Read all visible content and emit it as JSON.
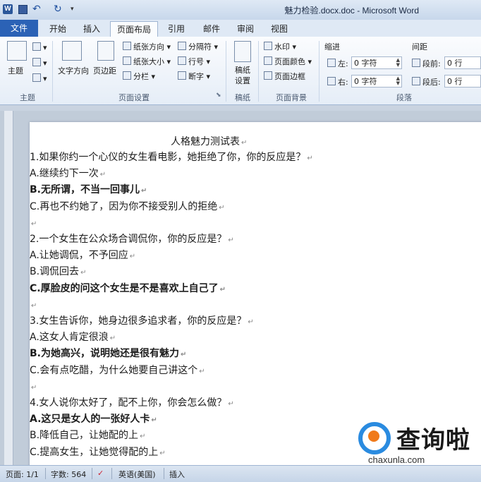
{
  "window": {
    "title": "魅力检验.docx.doc - Microsoft Word",
    "app_logo": "W"
  },
  "tabs": [
    {
      "label": "文件"
    },
    {
      "label": "开始"
    },
    {
      "label": "插入"
    },
    {
      "label": "页面布局"
    },
    {
      "label": "引用"
    },
    {
      "label": "邮件"
    },
    {
      "label": "审阅"
    },
    {
      "label": "视图"
    }
  ],
  "ribbon": {
    "theme": {
      "main": "主题",
      "group": "主题"
    },
    "page_setup": {
      "text_direction": "文字方向",
      "margins": "页边距",
      "orientation": "纸张方向",
      "size": "纸张大小",
      "columns": "分栏",
      "breaks": "分隔符",
      "line_numbers": "行号",
      "hyphenation": "断字",
      "group": "页面设置"
    },
    "paper": {
      "label": "稿纸设置",
      "group": "稿纸"
    },
    "page_background": {
      "watermark": "水印",
      "page_color": "页面颜色",
      "page_border": "页面边框",
      "group": "页面背景"
    },
    "paragraph": {
      "indent": "缩进",
      "left": "左:",
      "left_value": "0 字符",
      "right": "右:",
      "right_value": "0 字符",
      "spacing": "间距",
      "before": "段前:",
      "before_value": "0 行",
      "after": "段后:",
      "after_value": "0 行",
      "group": "段落"
    }
  },
  "document": {
    "title": "人格魅力测试表",
    "lines": [
      {
        "text": "1.如果你约一个心仪的女生看电影，她拒绝了你，你的反应是？",
        "bold": false
      },
      {
        "text": "A.继续约下一次",
        "bold": false
      },
      {
        "text": "B.无所谓，不当一回事儿",
        "bold": true
      },
      {
        "text": "C.再也不约她了，因为你不接受别人的拒绝",
        "bold": false
      },
      {
        "text": "",
        "bold": false
      },
      {
        "text": "2.一个女生在公众场合调侃你，你的反应是？",
        "bold": false
      },
      {
        "text": "A.让她调侃，不予回应",
        "bold": false
      },
      {
        "text": "B.调侃回去",
        "bold": false
      },
      {
        "text": "C.厚脸皮的问这个女生是不是喜欢上自己了",
        "bold": true
      },
      {
        "text": "",
        "bold": false
      },
      {
        "text": "3.女生告诉你，她身边很多追求者，你的反应是？",
        "bold": false
      },
      {
        "text": "A.这女人肯定很浪",
        "bold": false
      },
      {
        "text": "B.为她高兴，说明她还是很有魅力",
        "bold": true
      },
      {
        "text": "C.会有点吃醋，为什么她要自己讲这个",
        "bold": false
      },
      {
        "text": "",
        "bold": false
      },
      {
        "text": "4.女人说你太好了，配不上你，你会怎么做？",
        "bold": false
      },
      {
        "text": "A.这只是女人的一张好人卡",
        "bold": true
      },
      {
        "text": "B.降低自己，让她配的上",
        "bold": false
      },
      {
        "text": "C.提高女生，让她觉得配的上",
        "bold": false
      }
    ]
  },
  "status": {
    "page": "页面: 1/1",
    "words": "字数: 564",
    "language": "英语(美国)",
    "mode": "插入"
  },
  "watermark": {
    "brand": "查询啦",
    "url": "chaxunla.com"
  }
}
